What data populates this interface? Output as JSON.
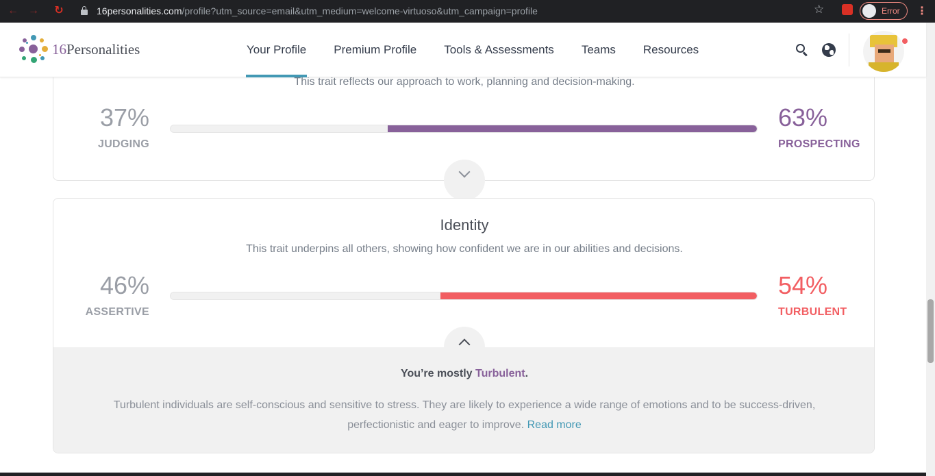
{
  "browser": {
    "url_host": "16personalities.com",
    "url_path": "/profile?utm_source=email&utm_medium=welcome-virtuoso&utm_campaign=profile",
    "profile_chip_label": "Error"
  },
  "site": {
    "logo_number": "16",
    "logo_word": "Personalities",
    "nav": [
      {
        "label": "Your Profile",
        "active": true
      },
      {
        "label": "Premium Profile",
        "active": false
      },
      {
        "label": "Tools & Assessments",
        "active": false
      },
      {
        "label": "Teams",
        "active": false
      },
      {
        "label": "Resources",
        "active": false
      }
    ]
  },
  "traits": {
    "tactics": {
      "description": "This trait reflects our approach to work, planning and decision-making.",
      "left_percent": "37%",
      "left_label": "JUDGING",
      "right_percent": "63%",
      "right_label": "PROSPECTING",
      "right_value": 0.63,
      "color": "#88619a"
    },
    "identity": {
      "title": "Identity",
      "description": "This trait underpins all others, showing how confident we are in our abilities and decisions.",
      "left_percent": "46%",
      "left_label": "ASSERTIVE",
      "right_percent": "54%",
      "right_label": "TURBULENT",
      "right_value": 0.54,
      "color": "#f25e62",
      "mostly_prefix": "You’re mostly ",
      "mostly_trait": "Turbulent",
      "mostly_suffix": ".",
      "explanation": "Turbulent individuals are self-conscious and sensitive to stress. They are likely to experience a wide range of emotions and to be success-driven, perfectionistic and eager to improve.",
      "read_more": "Read more"
    }
  },
  "icons": {
    "search": "search-icon",
    "language": "globe-icon",
    "expand": "chevron-down-icon",
    "collapse": "chevron-up-icon"
  }
}
